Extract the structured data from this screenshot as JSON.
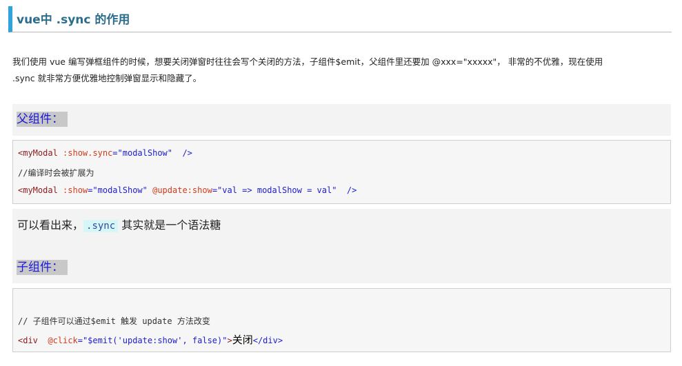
{
  "title": "vue中 .sync 的作用",
  "intro": {
    "line1": "我们使用 vue 编写弹框组件的时候，想要关闭弹窗时往往会写个关闭的方法，子组件$emit，父组件里还要加 @xxx=\"xxxxx\"， 非常的不优雅，现在使用",
    "line2": ".sync 就非常方便优雅地控制弹窗显示和隐藏了。"
  },
  "parent_heading": "父组件：",
  "code1": {
    "line1": {
      "tag_open": "<myModal",
      "attr": ":show.sync",
      "eq": "=",
      "val": "\"modalShow\"",
      "close": "/>"
    },
    "line2_comment": "//编译时会被扩展为",
    "line3": {
      "tag_open": "<myModal",
      "attr1": ":show",
      "eq1": "=",
      "val1": "\"modalShow\"",
      "attr2": "@update:show",
      "eq2": "=",
      "val2": "\"val => modalShow = val\"",
      "close": "/>"
    }
  },
  "note": {
    "prefix": "可以看出来，",
    "code": ".sync",
    "suffix": " 其实就是一个语法糖"
  },
  "child_heading": "子组件：",
  "code2": {
    "comment": "// 子组件可以通过$emit 触发 update 方法改变",
    "tag_open": "<div",
    "attr": "@click",
    "eq": "=",
    "val": "\"$emit('update:show', false)\"",
    "gt": ">",
    "text": "关闭",
    "tag_close": "</div>"
  }
}
